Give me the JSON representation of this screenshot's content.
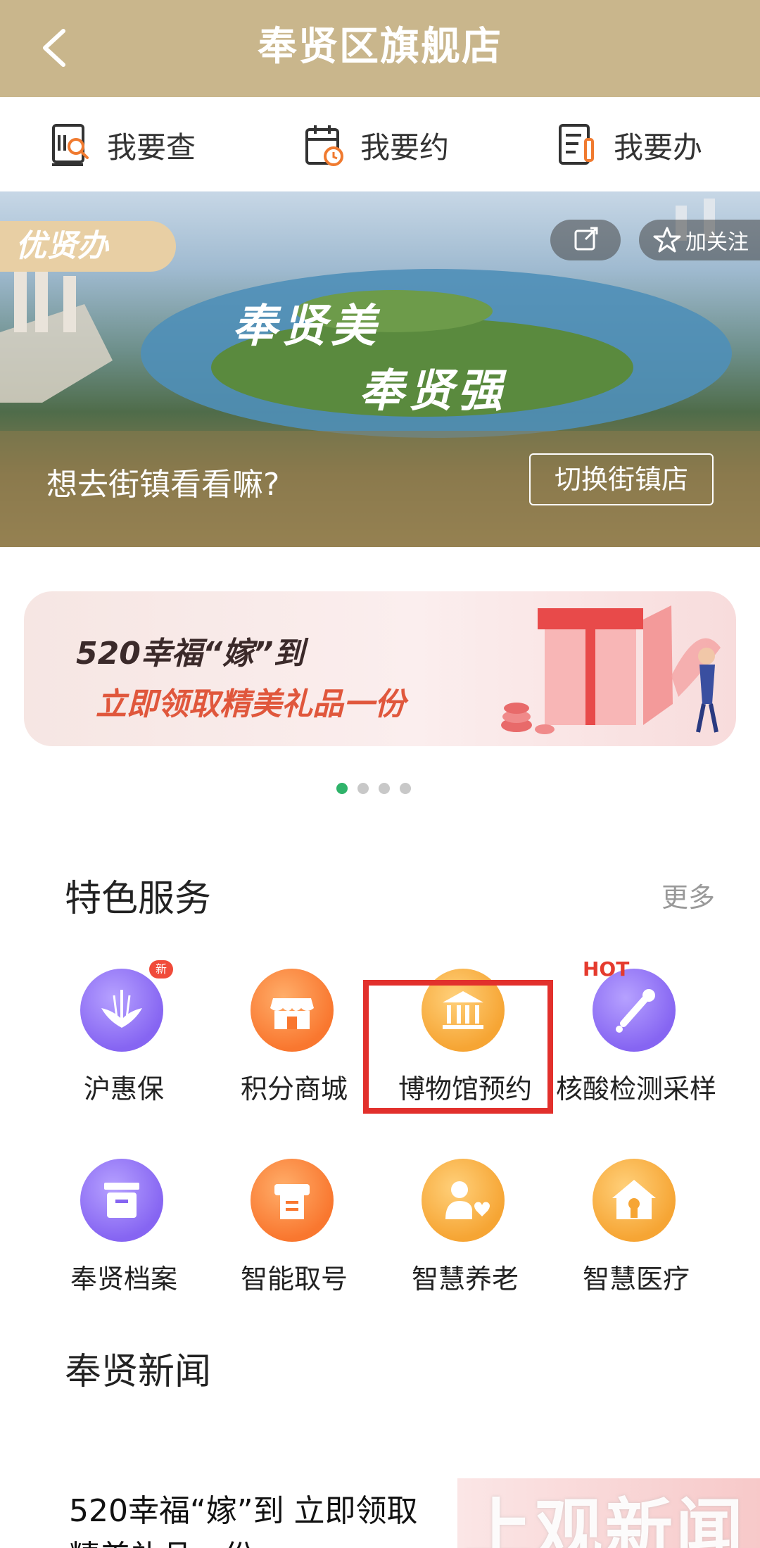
{
  "header": {
    "title": "奉贤区旗舰店"
  },
  "quick_nav": [
    {
      "label": "我要查",
      "icon": "search-doc-icon"
    },
    {
      "label": "我要约",
      "icon": "calendar-clock-icon"
    },
    {
      "label": "我要办",
      "icon": "document-pen-icon"
    }
  ],
  "banner": {
    "badge": "优贤办",
    "follow_label": "加关注",
    "slogan_line1": "奉贤美",
    "slogan_line2": "奉贤强",
    "question": "想去街镇看看嘛?",
    "switch_label": "切换街镇店"
  },
  "promo": {
    "line1": "520幸福“嫁”到",
    "line2": "立即领取精美礼品一份",
    "dots": 4,
    "active_dot": 0
  },
  "featured": {
    "title": "特色服务",
    "more_label": "更多",
    "items": [
      {
        "label": "沪惠保",
        "icon": "lotus-icon",
        "tag": "新"
      },
      {
        "label": "积分商城",
        "icon": "store-icon"
      },
      {
        "label": "博物馆预约",
        "icon": "museum-icon"
      },
      {
        "label": "核酸检测采样",
        "icon": "dropper-icon",
        "tag": "HOT"
      },
      {
        "label": "奉贤档案",
        "icon": "archive-box-icon"
      },
      {
        "label": "智能取号",
        "icon": "ticket-machine-icon"
      },
      {
        "label": "智慧养老",
        "icon": "elder-heart-icon"
      },
      {
        "label": "智慧医疗",
        "icon": "medical-house-icon"
      }
    ]
  },
  "news": {
    "title": "奉贤新闻",
    "first_item_line1": "520幸福“嫁”到 立即领取",
    "first_item_line2": "精美礼品一份",
    "watermark": "上观新闻"
  },
  "colors": {
    "header_bg": "#c9b68c",
    "highlight_border": "#e2302c",
    "dot_active": "#2fb36a"
  }
}
